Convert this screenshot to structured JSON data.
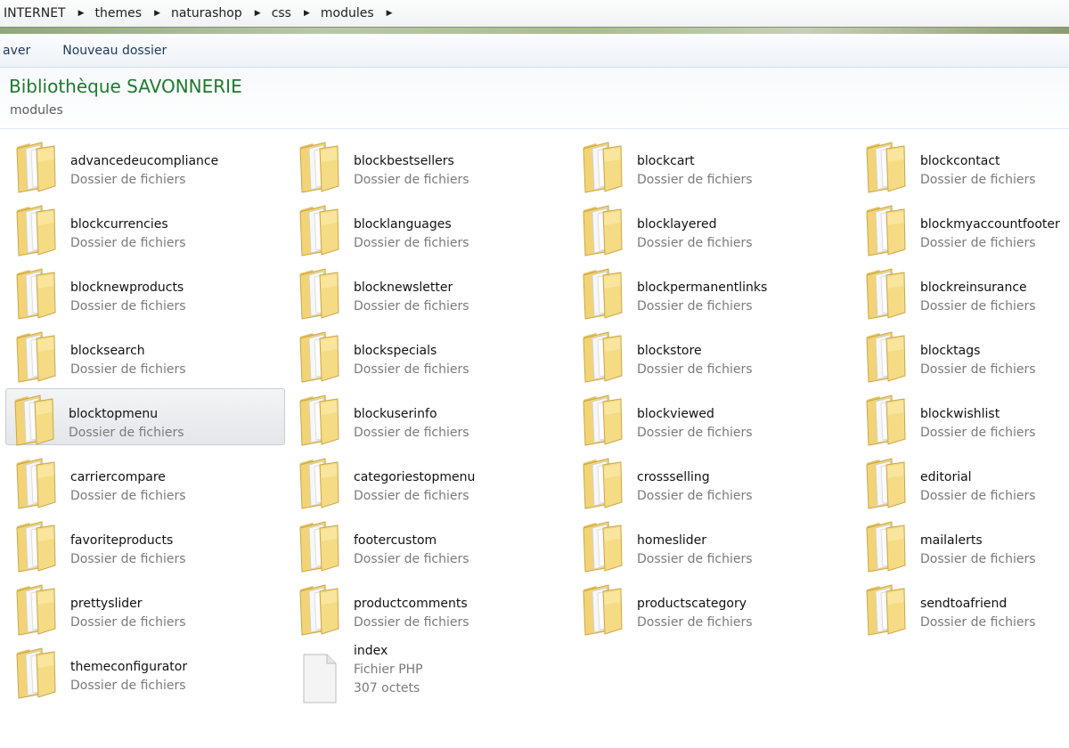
{
  "address_bar": {
    "crumbs": [
      "INTERNET",
      "themes",
      "naturashop",
      "css",
      "modules"
    ]
  },
  "toolbar": {
    "cut_button": "aver",
    "new_folder_button": "Nouveau dossier"
  },
  "library": {
    "title": "Bibliothèque SAVONNERIE",
    "subtitle": "modules"
  },
  "colors": {
    "title_green": "#1e7a2e",
    "folder_yellow": "#f1d676",
    "selection": "#e4e6ea"
  },
  "items": [
    {
      "name": "advancedeucompliance",
      "type": "Dossier de fichiers",
      "icon": "folder-icon"
    },
    {
      "name": "blockbestsellers",
      "type": "Dossier de fichiers",
      "icon": "folder-icon"
    },
    {
      "name": "blockcart",
      "type": "Dossier de fichiers",
      "icon": "folder-icon"
    },
    {
      "name": "blockcontact",
      "type": "Dossier de fichiers",
      "icon": "folder-icon"
    },
    {
      "name": "blockcurrencies",
      "type": "Dossier de fichiers",
      "icon": "folder-icon"
    },
    {
      "name": "blocklanguages",
      "type": "Dossier de fichiers",
      "icon": "folder-icon"
    },
    {
      "name": "blocklayered",
      "type": "Dossier de fichiers",
      "icon": "folder-icon"
    },
    {
      "name": "blockmyaccountfooter",
      "type": "Dossier de fichiers",
      "icon": "folder-icon"
    },
    {
      "name": "blocknewproducts",
      "type": "Dossier de fichiers",
      "icon": "folder-icon"
    },
    {
      "name": "blocknewsletter",
      "type": "Dossier de fichiers",
      "icon": "folder-icon"
    },
    {
      "name": "blockpermanentlinks",
      "type": "Dossier de fichiers",
      "icon": "folder-icon"
    },
    {
      "name": "blockreinsurance",
      "type": "Dossier de fichiers",
      "icon": "folder-icon"
    },
    {
      "name": "blocksearch",
      "type": "Dossier de fichiers",
      "icon": "folder-icon"
    },
    {
      "name": "blockspecials",
      "type": "Dossier de fichiers",
      "icon": "folder-icon"
    },
    {
      "name": "blockstore",
      "type": "Dossier de fichiers",
      "icon": "folder-icon"
    },
    {
      "name": "blocktags",
      "type": "Dossier de fichiers",
      "icon": "folder-icon"
    },
    {
      "name": "blocktopmenu",
      "type": "Dossier de fichiers",
      "icon": "folder-icon",
      "selected": true
    },
    {
      "name": "blockuserinfo",
      "type": "Dossier de fichiers",
      "icon": "folder-icon"
    },
    {
      "name": "blockviewed",
      "type": "Dossier de fichiers",
      "icon": "folder-icon"
    },
    {
      "name": "blockwishlist",
      "type": "Dossier de fichiers",
      "icon": "folder-icon"
    },
    {
      "name": "carriercompare",
      "type": "Dossier de fichiers",
      "icon": "folder-icon"
    },
    {
      "name": "categoriestopmenu",
      "type": "Dossier de fichiers",
      "icon": "folder-icon"
    },
    {
      "name": "crossselling",
      "type": "Dossier de fichiers",
      "icon": "folder-icon"
    },
    {
      "name": "editorial",
      "type": "Dossier de fichiers",
      "icon": "folder-icon"
    },
    {
      "name": "favoriteproducts",
      "type": "Dossier de fichiers",
      "icon": "folder-icon"
    },
    {
      "name": "footercustom",
      "type": "Dossier de fichiers",
      "icon": "folder-icon"
    },
    {
      "name": "homeslider",
      "type": "Dossier de fichiers",
      "icon": "folder-icon"
    },
    {
      "name": "mailalerts",
      "type": "Dossier de fichiers",
      "icon": "folder-icon"
    },
    {
      "name": "prettyslider",
      "type": "Dossier de fichiers",
      "icon": "folder-icon"
    },
    {
      "name": "productcomments",
      "type": "Dossier de fichiers",
      "icon": "folder-icon"
    },
    {
      "name": "productscategory",
      "type": "Dossier de fichiers",
      "icon": "folder-icon"
    },
    {
      "name": "sendtoafriend",
      "type": "Dossier de fichiers",
      "icon": "folder-icon"
    },
    {
      "name": "themeconfigurator",
      "type": "Dossier de fichiers",
      "icon": "folder-icon"
    },
    {
      "name": "index",
      "type": "Fichier PHP",
      "size": "307 octets",
      "icon": "file-icon"
    }
  ]
}
